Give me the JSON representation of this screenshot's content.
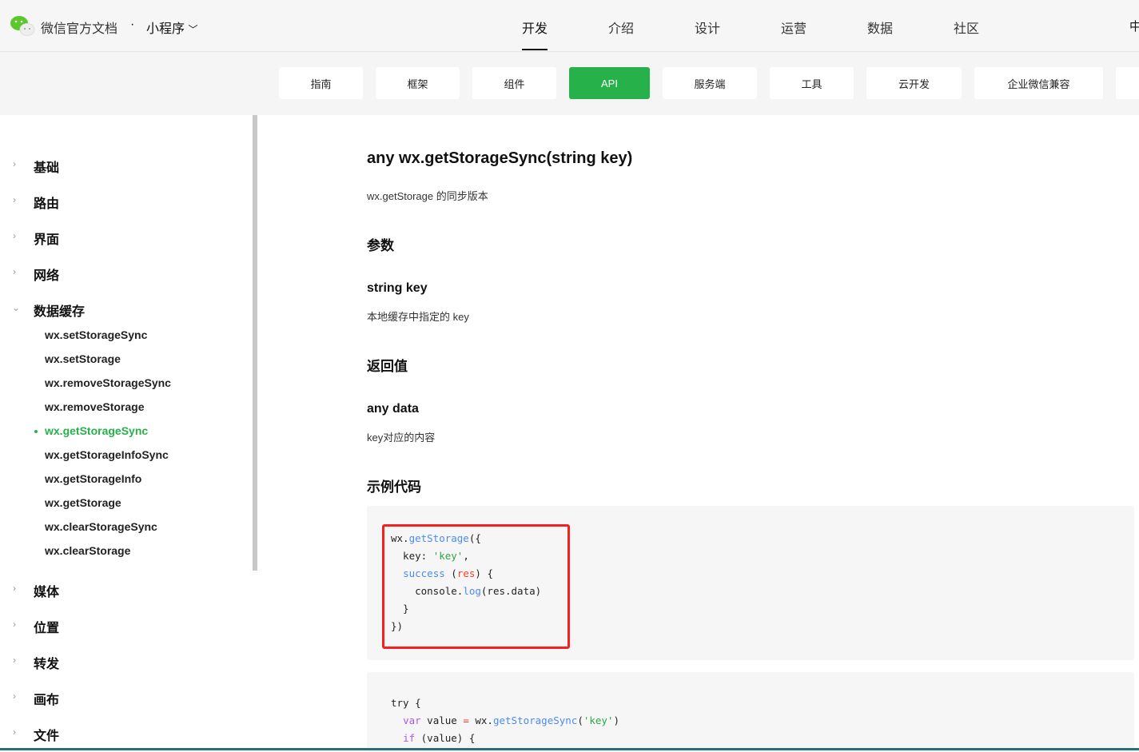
{
  "header": {
    "brand": "微信官方文档",
    "separator": "·",
    "product": "小程序",
    "nav": [
      "开发",
      "介绍",
      "设计",
      "运营",
      "数据",
      "社区"
    ],
    "lang": "中"
  },
  "subnav": [
    "指南",
    "框架",
    "组件",
    "API",
    "服务端",
    "工具",
    "云开发",
    "企业微信兼容"
  ],
  "sidebar": {
    "categories_top": [
      "基础",
      "路由",
      "界面",
      "网络",
      "数据缓存"
    ],
    "items": [
      "wx.setStorageSync",
      "wx.setStorage",
      "wx.removeStorageSync",
      "wx.removeStorage",
      "wx.getStorageSync",
      "wx.getStorageInfoSync",
      "wx.getStorageInfo",
      "wx.getStorage",
      "wx.clearStorageSync",
      "wx.clearStorage"
    ],
    "categories_bottom": [
      "媒体",
      "位置",
      "转发",
      "画布",
      "文件"
    ]
  },
  "content": {
    "title": "any wx.getStorageSync(string key)",
    "desc": "wx.getStorage 的同步版本",
    "params_heading": "参数",
    "param_name": "string key",
    "param_desc": "本地缓存中指定的 key",
    "return_heading": "返回值",
    "return_name": "any data",
    "return_desc": "key对应的内容",
    "example_heading": "示例代码"
  },
  "colors": {
    "accent": "#27b14a",
    "highlight": "#f5211f"
  }
}
